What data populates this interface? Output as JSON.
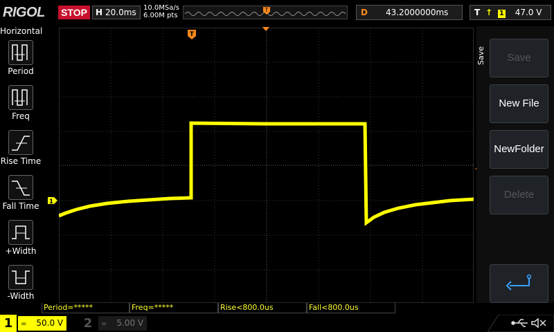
{
  "top": {
    "brand": "RIGOL",
    "run_state": "STOP",
    "horizontal": {
      "label": "H",
      "value": "20.0ms"
    },
    "sample_rate": "10.0MSa/s",
    "memory_depth": "6.00M pts",
    "delay": {
      "label": "D",
      "value": "43.2000000ms"
    },
    "trigger": {
      "label": "T",
      "source": "1",
      "level": "47.0 V"
    }
  },
  "left_menu": {
    "title": "Horizontal",
    "items": [
      {
        "label": "Period"
      },
      {
        "label": "Freq"
      },
      {
        "label": "Rise Time"
      },
      {
        "label": "Fall Time"
      },
      {
        "label": "+Width"
      },
      {
        "label": "-Width"
      }
    ]
  },
  "right_menu": {
    "title": "Save",
    "buttons": [
      {
        "label": "Save",
        "enabled": false
      },
      {
        "label": "New File",
        "enabled": true
      },
      {
        "label": "NewFolder",
        "enabled": true
      },
      {
        "label": "Delete",
        "enabled": false
      }
    ]
  },
  "measurements": [
    {
      "text": "Period=*****"
    },
    {
      "text": "Freq=*****"
    },
    {
      "text": "Rise<800.0us"
    },
    {
      "text": "Fall<800.0us"
    }
  ],
  "bottom": {
    "ch1": {
      "number": "1",
      "scale": "50.0 V"
    },
    "ch2": {
      "number": "2",
      "scale": "5.00 V"
    }
  },
  "markers": {
    "trigger_marker": "T",
    "channel1_marker": "1"
  },
  "colors": {
    "trace": "#ffff00",
    "accent": "#ff8a1a",
    "stop": "#c8102e"
  }
}
